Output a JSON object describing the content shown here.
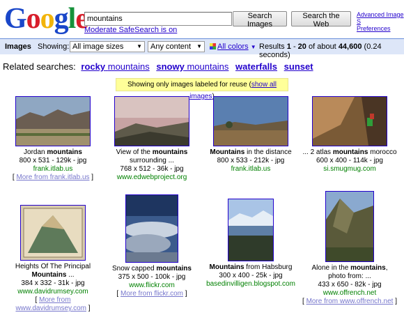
{
  "logo": {
    "letters": [
      "G",
      "o",
      "o",
      "g",
      "l",
      "e"
    ]
  },
  "search": {
    "query": "mountains",
    "images_button": "Search Images",
    "web_button": "Search the Web",
    "advanced_line1": "Advanced Image S",
    "advanced_line2": "Preferences"
  },
  "safesearch": "Moderate SafeSearch is on",
  "toolbar": {
    "section": "Images",
    "showing_label": "Showing:",
    "size": "All image sizes",
    "content": "Any content",
    "colors": "All colors",
    "results_prefix": "Results",
    "results_from": "1",
    "results_dash": "-",
    "results_to": "20",
    "results_of": "of about",
    "results_total": "44,600",
    "results_time": "(0.24 seconds)"
  },
  "related": {
    "label": "Related searches:",
    "items": [
      {
        "bold": "rocky",
        "rest": "mountains"
      },
      {
        "bold": "snowy",
        "rest": "mountains"
      },
      {
        "bold": "waterfalls",
        "rest": ""
      },
      {
        "bold": "sunset",
        "rest": ""
      }
    ]
  },
  "notice": {
    "text": "Showing only images labeled for reuse (",
    "link": "show all images",
    "close": ")"
  },
  "results": [
    {
      "pre": "Jordan ",
      "bold": "mountains",
      "post": "",
      "dims": "800 x 531 - 129k - jpg",
      "url": "frank.itlab.us",
      "more": "More from frank.itlab.us"
    },
    {
      "pre": "View of the ",
      "bold": "mountains",
      "post": " surrounding ...",
      "dims": "768 x 512 - 36k - jpg",
      "url": "www.edwebproject.org",
      "more": ""
    },
    {
      "pre": "",
      "bold": "Mountains",
      "post": " in the distance",
      "dims": "800 x 533 - 212k - jpg",
      "url": "frank.itlab.us",
      "more": ""
    },
    {
      "pre": "... 2 atlas ",
      "bold": "mountains",
      "post": " morocco",
      "dims": "600 x 400 - 114k - jpg",
      "url": "si.smugmug.com",
      "more": ""
    },
    {
      "pre": "Heights Of The Principal ",
      "bold": "Mountains",
      "post": " ...",
      "dims": "384 x 332 - 31k - jpg",
      "url": "www.davidrumsey.com",
      "more": "More from www.davidrumsey.com"
    },
    {
      "pre": "Snow capped ",
      "bold": "mountains",
      "post": "",
      "dims": "375 x 500 - 100k - jpg",
      "url": "www.flickr.com",
      "more": "More from flickr.com"
    },
    {
      "pre": "",
      "bold": "Mountains",
      "post": " from Habsburg",
      "dims": "300 x 400 - 25k - jpg",
      "url": "basedinvilligen.blogspot.com",
      "more": ""
    },
    {
      "pre": "Alone in the ",
      "bold": "mountains",
      "post": ", photo from: ...",
      "dims": "433 x 650 - 82k - jpg",
      "url": "www.offrench.net",
      "more": "More from www.offrench.net"
    }
  ]
}
